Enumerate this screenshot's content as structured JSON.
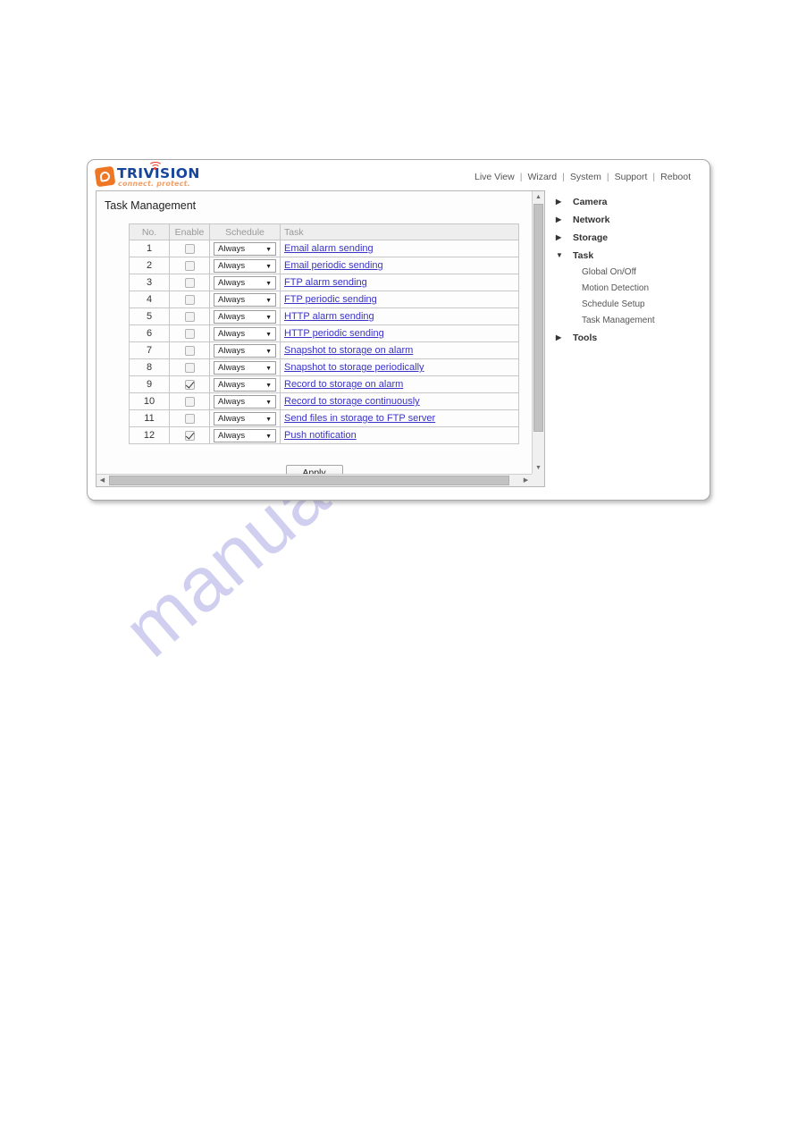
{
  "watermark": {
    "text": "manualshive.com"
  },
  "header": {
    "logo": {
      "wordmark": "TRIVISION",
      "tagline": "connect. protect.",
      "mark_icon": "camera-lens-icon",
      "wifi_icon": "wifi-signal-icon"
    },
    "nav": {
      "items": [
        {
          "label": "Live View"
        },
        {
          "label": "Wizard"
        },
        {
          "label": "System"
        },
        {
          "label": "Support"
        },
        {
          "label": "Reboot"
        }
      ],
      "separator": "|"
    }
  },
  "content": {
    "page_title": "Task Management",
    "table": {
      "columns": [
        "No.",
        "Enable",
        "Schedule",
        "Task"
      ],
      "rows": [
        {
          "no": "1",
          "enabled": false,
          "schedule": "Always",
          "task": "Email alarm sending"
        },
        {
          "no": "2",
          "enabled": false,
          "schedule": "Always",
          "task": "Email periodic sending"
        },
        {
          "no": "3",
          "enabled": false,
          "schedule": "Always",
          "task": "FTP alarm sending"
        },
        {
          "no": "4",
          "enabled": false,
          "schedule": "Always",
          "task": "FTP periodic sending"
        },
        {
          "no": "5",
          "enabled": false,
          "schedule": "Always",
          "task": "HTTP alarm sending"
        },
        {
          "no": "6",
          "enabled": false,
          "schedule": "Always",
          "task": "HTTP periodic sending"
        },
        {
          "no": "7",
          "enabled": false,
          "schedule": "Always",
          "task": "Snapshot to storage on alarm"
        },
        {
          "no": "8",
          "enabled": false,
          "schedule": "Always",
          "task": "Snapshot to storage periodically"
        },
        {
          "no": "9",
          "enabled": true,
          "schedule": "Always",
          "task": "Record to storage on alarm"
        },
        {
          "no": "10",
          "enabled": false,
          "schedule": "Always",
          "task": "Record to storage continuously"
        },
        {
          "no": "11",
          "enabled": false,
          "schedule": "Always",
          "task": "Send files in storage to FTP server"
        },
        {
          "no": "12",
          "enabled": true,
          "schedule": "Always",
          "task": "Push notification"
        }
      ]
    },
    "apply_label": "Apply",
    "scrollbars": {
      "vertical": {
        "up_arrow": "▲",
        "down_arrow": "▼"
      },
      "horizontal": {
        "left_arrow": "◀",
        "right_arrow": "▶"
      }
    }
  },
  "sidebar": {
    "items": [
      {
        "label": "Camera",
        "level": "top",
        "expanded": false,
        "marker": "▶"
      },
      {
        "label": "Network",
        "level": "top",
        "expanded": false,
        "marker": "▶"
      },
      {
        "label": "Storage",
        "level": "top",
        "expanded": false,
        "marker": "▶"
      },
      {
        "label": "Task",
        "level": "top",
        "expanded": true,
        "marker": "▼"
      },
      {
        "label": "Global On/Off",
        "level": "sub"
      },
      {
        "label": "Motion Detection",
        "level": "sub"
      },
      {
        "label": "Schedule Setup",
        "level": "sub"
      },
      {
        "label": "Task Management",
        "level": "sub"
      },
      {
        "label": "Tools",
        "level": "top",
        "expanded": false,
        "marker": "▶"
      }
    ]
  },
  "colors": {
    "brand_orange": "#ef7723",
    "brand_blue": "#18449a",
    "link": "#3a33c6",
    "watermark": "#c9c7ee"
  }
}
